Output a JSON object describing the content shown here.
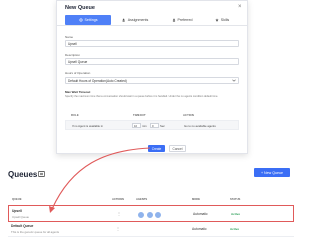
{
  "modal": {
    "title": "New Queue",
    "close_glyph": "×",
    "tabs": [
      {
        "label": "Settings",
        "icon": "gear-icon"
      },
      {
        "label": "Assignments",
        "icon": "users-icon"
      },
      {
        "label": "Preferred",
        "icon": "user-icon"
      },
      {
        "label": "Skills",
        "icon": "star-icon"
      }
    ],
    "fields": {
      "name": {
        "label": "Name",
        "value": "Upsell"
      },
      "description": {
        "label": "Description",
        "value": "Upsell Queue"
      },
      "hours": {
        "label": "Hours of Operation",
        "value": "Default Hours of Operation(Auto Created)"
      }
    },
    "max_wait": {
      "title": "Max Wait Timeout",
      "hint": "Specify the maximum time that a conversation should wait in a queue before it is handled. Under the no agents condition default time."
    },
    "rules": {
      "headers": [
        "RULE",
        "TIMEOUT",
        "ACTION"
      ],
      "row": {
        "rule": "If no Agent is available in",
        "value": "10",
        "unit1": "min",
        "value2": "0",
        "unit2": "Sec",
        "action": "Go to no available agents"
      }
    },
    "buttons": {
      "create": "Create",
      "cancel": "Cancel"
    }
  },
  "page": {
    "title": "Queues",
    "new_button": "+ New Queue",
    "table": {
      "headers": [
        "QUEUE",
        "ACTIONS",
        "AGENTS",
        "MODE",
        "STATUS"
      ],
      "rows": [
        {
          "name": "Upsell",
          "description": "Upsell Queue",
          "actions": "⋮",
          "mode": "Automatic",
          "status": "Active",
          "agents": [
            "",
            "",
            ""
          ]
        },
        {
          "name": "Default Queue",
          "description": "This is the generic queue for all agents",
          "actions": "⋮",
          "mode": "Automatic",
          "status": "Active",
          "agents": []
        }
      ]
    }
  },
  "colors": {
    "accent": "#3b6ef5",
    "highlight": "#e05a5a",
    "status": "#2fa05a"
  }
}
